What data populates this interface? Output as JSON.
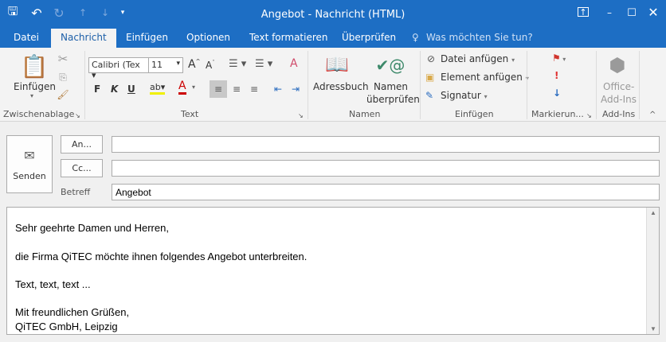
{
  "window": {
    "title": "Angebot - Nachricht (HTML)"
  },
  "tabs": [
    "Datei",
    "Nachricht",
    "Einfügen",
    "Optionen",
    "Text formatieren",
    "Überprüfen"
  ],
  "tell_me": "Was möchten Sie tun?",
  "ribbon": {
    "clipboard": {
      "paste": "Einfügen",
      "group": "Zwischenablage"
    },
    "text": {
      "font": "Calibri (Tex",
      "size": "11",
      "bold": "F",
      "italic": "K",
      "underline": "U",
      "group": "Text"
    },
    "names": {
      "addressbook": "Adressbuch",
      "check1": "Namen",
      "check2": "überprüfen",
      "group": "Namen"
    },
    "include": {
      "attach_file": "Datei anfügen",
      "attach_item": "Element anfügen",
      "signature": "Signatur",
      "group": "Einfügen"
    },
    "tags": {
      "group": "Markierun...",
      "important": "!"
    },
    "addins": {
      "office1": "Office-",
      "office2": "Add-Ins",
      "group": "Add-Ins"
    }
  },
  "compose": {
    "send": "Senden",
    "to": "An...",
    "cc": "Cc...",
    "subject_label": "Betreff",
    "to_value": "",
    "cc_value": "",
    "subject": "Angebot"
  },
  "body": [
    "Sehr geehrte Damen und Herren,",
    "die Firma QiTEC möchte ihnen folgendes Angebot unterbreiten.",
    "Text, text, text ...",
    "Mit freundlichen Grüßen,",
    "QiTEC GmbH, Leipzig"
  ]
}
